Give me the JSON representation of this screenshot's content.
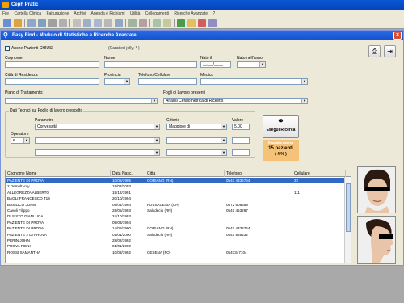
{
  "app": {
    "title": "Ceph Pratic",
    "menu": [
      "File",
      "Cartella Clinica",
      "Fatturazione",
      "Archivi",
      "Agenda e Richiami",
      "Utilità",
      "Collegamenti",
      "Ricerche Avanzate",
      "?"
    ]
  },
  "window": {
    "title": "Easy Find - Modulo di Statistiche e Ricerche Avanzate",
    "close": "×"
  },
  "form": {
    "chk_chiusi_label": "Anche Pazienti CHIUSI",
    "jolly_hint": "(Caratteri jolly: * )",
    "cognome_label": "Cognome",
    "cognome_value": "",
    "nome_label": "Nome",
    "nome_value": "",
    "nato_il_label": "Nato il",
    "nato_il_value": "__/__/____",
    "nato_anno_label": "Nato nell'anno:",
    "nato_anno_value": "",
    "citta_label": "Città di Residenza",
    "citta_value": "",
    "provincia_label": "Provincia",
    "provincia_value": "",
    "telefono_label": "Telefono/Cellulare",
    "telefono_value": "",
    "medico_label": "Medico",
    "medico_value": "",
    "piano_label": "Piano di Trattamento:",
    "piano_value": "",
    "fogli_label": "Fogli di Lavoro presenti",
    "fogli_value": "Analisi Cefalometrica di Ricketts"
  },
  "tech": {
    "group_title": "Dati Tecnici sul Foglio di lavoro prescelto",
    "parametro_label": "Parametro",
    "criterio_label": "Criterio",
    "valore_label": "Valore",
    "operatore_label": "Operatore",
    "operatore_value": "e",
    "row1": {
      "parametro": "Convessità",
      "criterio": "Maggiore di",
      "valore": "5,00"
    },
    "row2": {
      "parametro": "",
      "criterio": "",
      "valore": ""
    },
    "row3": {
      "parametro": "",
      "criterio": "",
      "valore": ""
    }
  },
  "actions": {
    "search_button": "Esegui Ricerca",
    "result_title": "Risultato ricerca",
    "result_count": "15 pazienti",
    "result_percent": "( 4 % )"
  },
  "results": {
    "columns": [
      "Cognome Nome",
      "Data Nasc.",
      "Città",
      "Telefono",
      "Cellulare"
    ],
    "rows": [
      [
        "PAZIENTE DI PROVA",
        "10/06/1995",
        "CORIANO (RN)",
        "0541 4336754",
        "22"
      ],
      [
        "2 Demolt -ray",
        "19/03/2003",
        "",
        "",
        ""
      ],
      [
        "ALLEGREZZA ALBERTO",
        "19/12/1991",
        "",
        "",
        "111"
      ],
      [
        "BAGLI FRANCESCO  T19",
        "20/10/1994",
        "",
        "",
        ""
      ],
      [
        "BASILICO JOHN",
        "09/04/1994",
        "FOSSACESIA (CH)",
        "0872 608559",
        ""
      ],
      [
        "Cavoli Filippo",
        "28/05/1993",
        "Saludecio (RN)",
        "0541 453267",
        ""
      ],
      [
        "DI SISTO GIANLUCA",
        "24/10/1993",
        "",
        "",
        ""
      ],
      [
        "PAZIENTE DI PROVA",
        "09/03/1994",
        "",
        "",
        ""
      ],
      [
        "PAZIENTE DI PROVA",
        "14/09/1990",
        "CORIANO (RN)",
        "0541 4336754",
        ""
      ],
      [
        "PAZIENTE 2 DI PROVA",
        "01/01/2000",
        "Saludecio (RN)",
        "0541 865432",
        ""
      ],
      [
        "PERIN JOHN",
        "28/02/1992",
        "",
        "",
        ""
      ],
      [
        "PROVA PIENI .",
        "01/01/2000",
        "",
        "",
        ""
      ],
      [
        "ROSSI SAMANTHA",
        "10/03/1992",
        "CESENA (FO)",
        "0547347104",
        ""
      ]
    ]
  },
  "icons": {
    "print": "print-icon",
    "exit": "exit-door-icon",
    "search": "binoculars-icon"
  }
}
